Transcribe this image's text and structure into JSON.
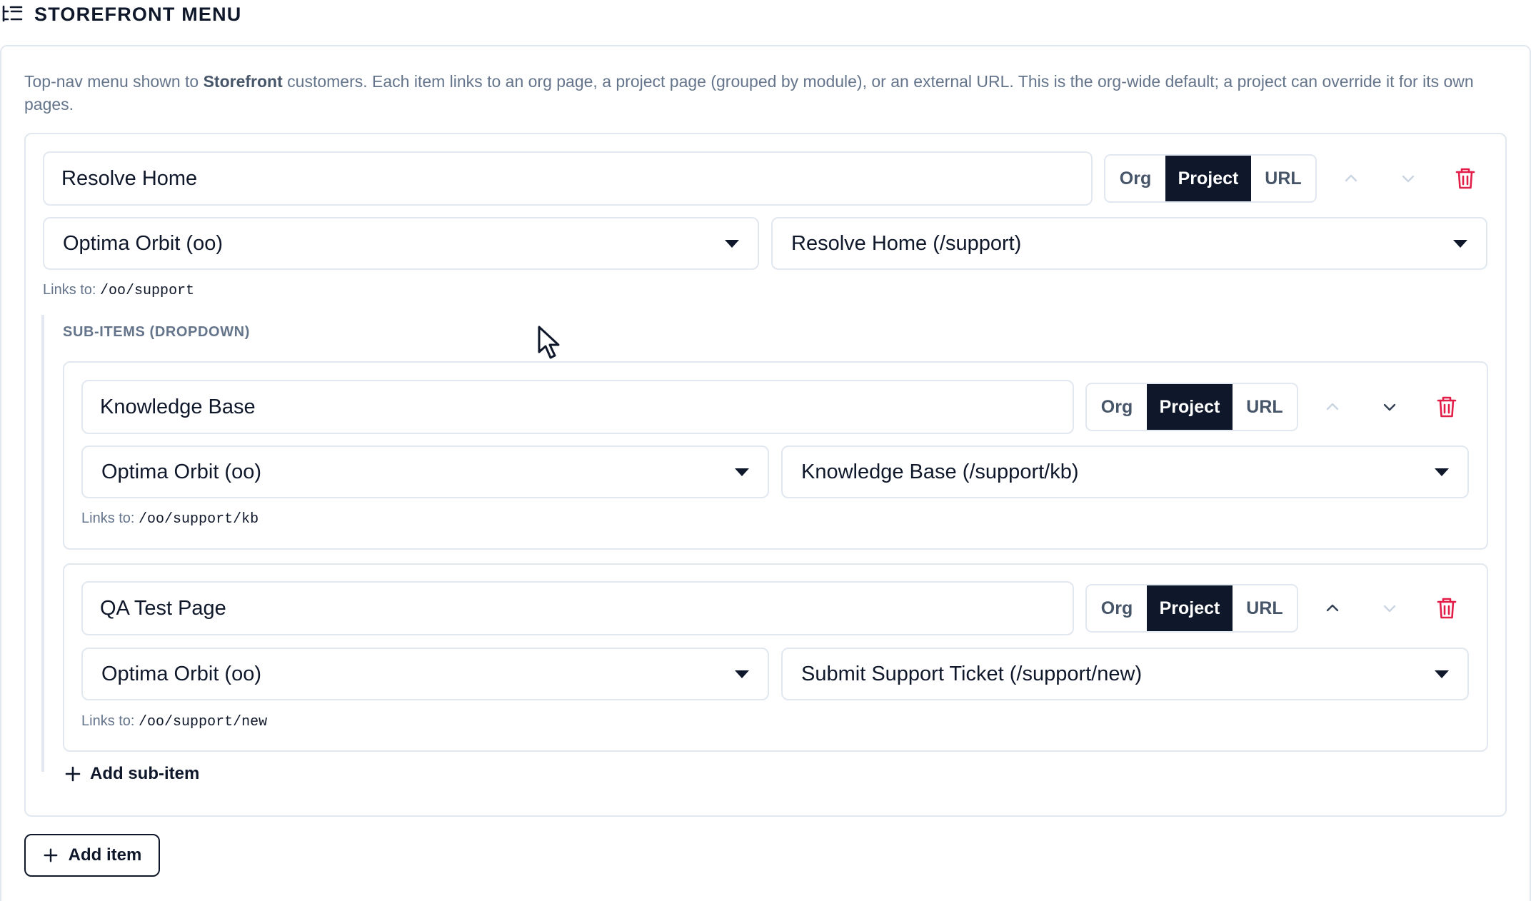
{
  "header": {
    "title": "STOREFRONT MENU",
    "icon": "list-tree-icon"
  },
  "description": {
    "before": "Top-nav menu shown to ",
    "bold": "Storefront",
    "after": " customers. Each item links to an org page, a project page (grouped by module), or an external URL. This is the org-wide default; a project can override it for its own pages."
  },
  "link_type_options": [
    "Org",
    "Project",
    "URL"
  ],
  "links_prefix": "Links to:",
  "colors": {
    "active_segment": "#0f172a",
    "delete": "#e11d48",
    "border": "#e2e8f0",
    "muted_text": "#64748b"
  },
  "item": {
    "label": "Resolve Home",
    "link_type": "Project",
    "project_select": "Optima Orbit (oo)",
    "page_select": "Resolve Home (/support)",
    "links_to": "/oo/support",
    "move_up_enabled": false,
    "move_down_enabled": false
  },
  "sub_items_heading": "SUB-ITEMS (DROPDOWN)",
  "sub_items": [
    {
      "label": "Knowledge Base",
      "link_type": "Project",
      "project_select": "Optima Orbit (oo)",
      "page_select": "Knowledge Base (/support/kb)",
      "links_to": "/oo/support/kb",
      "move_up_enabled": false,
      "move_down_enabled": true
    },
    {
      "label": "QA Test Page",
      "link_type": "Project",
      "project_select": "Optima Orbit (oo)",
      "page_select": "Submit Support Ticket (/support/new)",
      "links_to": "/oo/support/new",
      "move_up_enabled": true,
      "move_down_enabled": false
    }
  ],
  "add_sub_item_label": "Add sub-item",
  "add_item_label": "Add item"
}
